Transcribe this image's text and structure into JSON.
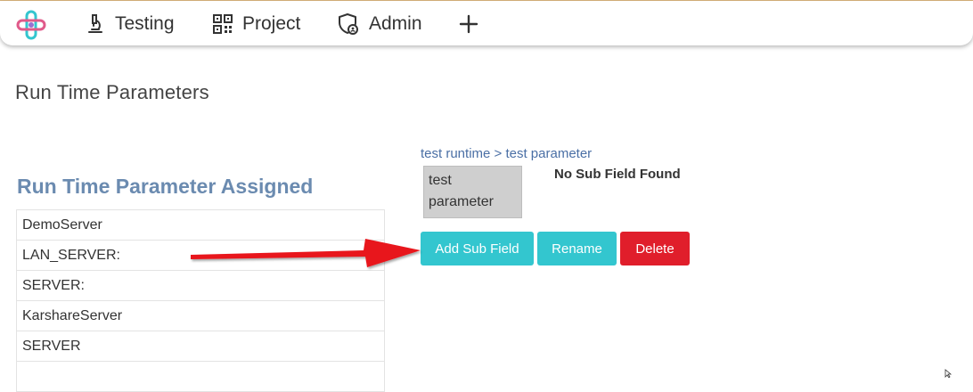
{
  "nav": {
    "items": [
      {
        "label": "Testing",
        "icon": "microscope-icon"
      },
      {
        "label": "Project",
        "icon": "qr-code-icon"
      },
      {
        "label": "Admin",
        "icon": "shield-user-icon"
      }
    ],
    "add_icon": "plus-icon"
  },
  "page": {
    "title": "Run Time Parameters"
  },
  "assigned": {
    "title": "Run Time Parameter Assigned",
    "items": [
      "DemoServer",
      "LAN_SERVER:",
      "SERVER:",
      "KarshareServer",
      "SERVER",
      ""
    ]
  },
  "detail": {
    "breadcrumb": "test runtime > test parameter",
    "parameter_name": "test parameter",
    "empty_message": "No Sub Field Found",
    "buttons": {
      "add": "Add Sub Field",
      "rename": "Rename",
      "delete": "Delete"
    }
  },
  "colors": {
    "accent": "#33c6cf",
    "danger": "#e01e2b",
    "heading": "#6b8bb0",
    "link": "#4a6fa5",
    "annotation": "#e8141c"
  }
}
